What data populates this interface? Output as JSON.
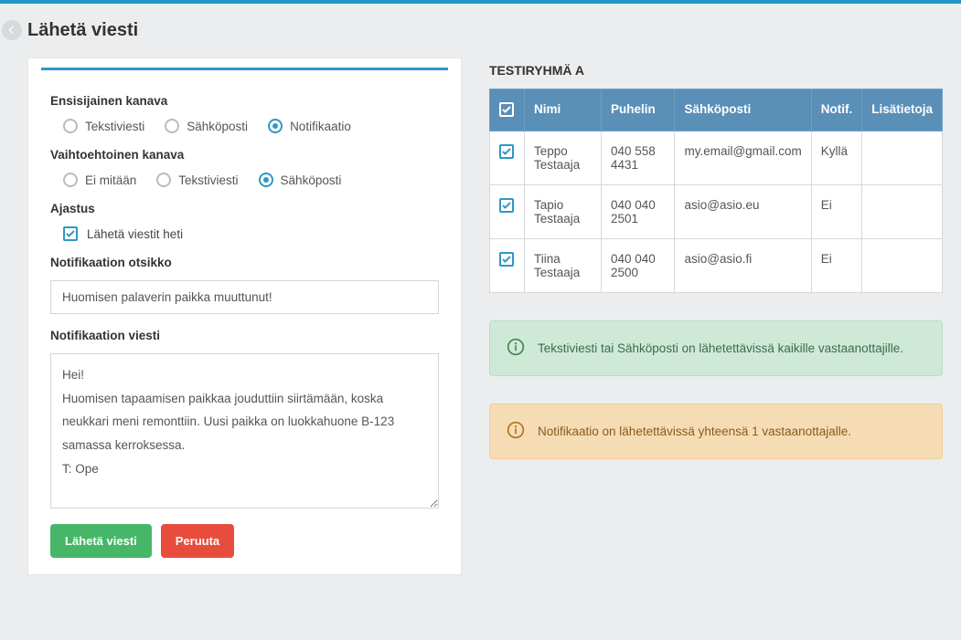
{
  "page_title": "Lähetä viesti",
  "labels": {
    "primary_channel": "Ensisijainen kanava",
    "alt_channel": "Vaihtoehtoinen kanava",
    "timing": "Ajastus",
    "notif_title": "Notifikaation otsikko",
    "notif_message": "Notifikaation viesti"
  },
  "primary_options": {
    "sms": "Tekstiviesti",
    "email": "Sähköposti",
    "notif": "Notifikaatio",
    "selected": "notif"
  },
  "alt_options": {
    "none": "Ei mitään",
    "sms": "Tekstiviesti",
    "email": "Sähköposti",
    "selected": "email"
  },
  "timing": {
    "send_now_label": "Lähetä viestit heti",
    "send_now_checked": true
  },
  "form": {
    "title_value": "Huomisen palaverin paikka muuttunut!",
    "message_value": "Hei!\nHuomisen tapaamisen paikkaa jouduttiin siirtämään, koska neukkari meni remonttiin. Uusi paikka on luokkahuone B-123 samassa kerroksessa.\nT: Ope"
  },
  "buttons": {
    "send": "Lähetä viesti",
    "cancel": "Peruuta"
  },
  "group_title": "TESTIRYHMÄ A",
  "columns": {
    "name": "Nimi",
    "phone": "Puhelin",
    "email": "Sähköposti",
    "notif": "Notif.",
    "extra": "Lisätietoja"
  },
  "recipients": [
    {
      "name": "Teppo Testaaja",
      "phone": "040 558 4431",
      "email": "my.email@gmail.com",
      "notif": "Kyllä",
      "extra": "",
      "checked": true
    },
    {
      "name": "Tapio Testaaja",
      "phone": "040 040 2501",
      "email": "asio@asio.eu",
      "notif": "Ei",
      "extra": "",
      "checked": true
    },
    {
      "name": "Tiina Testaaja",
      "phone": "040 040 2500",
      "email": "asio@asio.fi",
      "notif": "Ei",
      "extra": "",
      "checked": true
    }
  ],
  "alerts": {
    "green": "Tekstiviesti tai Sähköposti on lähetettävissä kaikille vastaanottajille.",
    "orange": "Notifikaatio on lähetettävissä yhteensä 1 vastaanottajalle."
  },
  "colors": {
    "accent": "#2e98c5",
    "green": "#46b768",
    "red": "#e84c3d",
    "th_bg": "#5a8fb8"
  }
}
